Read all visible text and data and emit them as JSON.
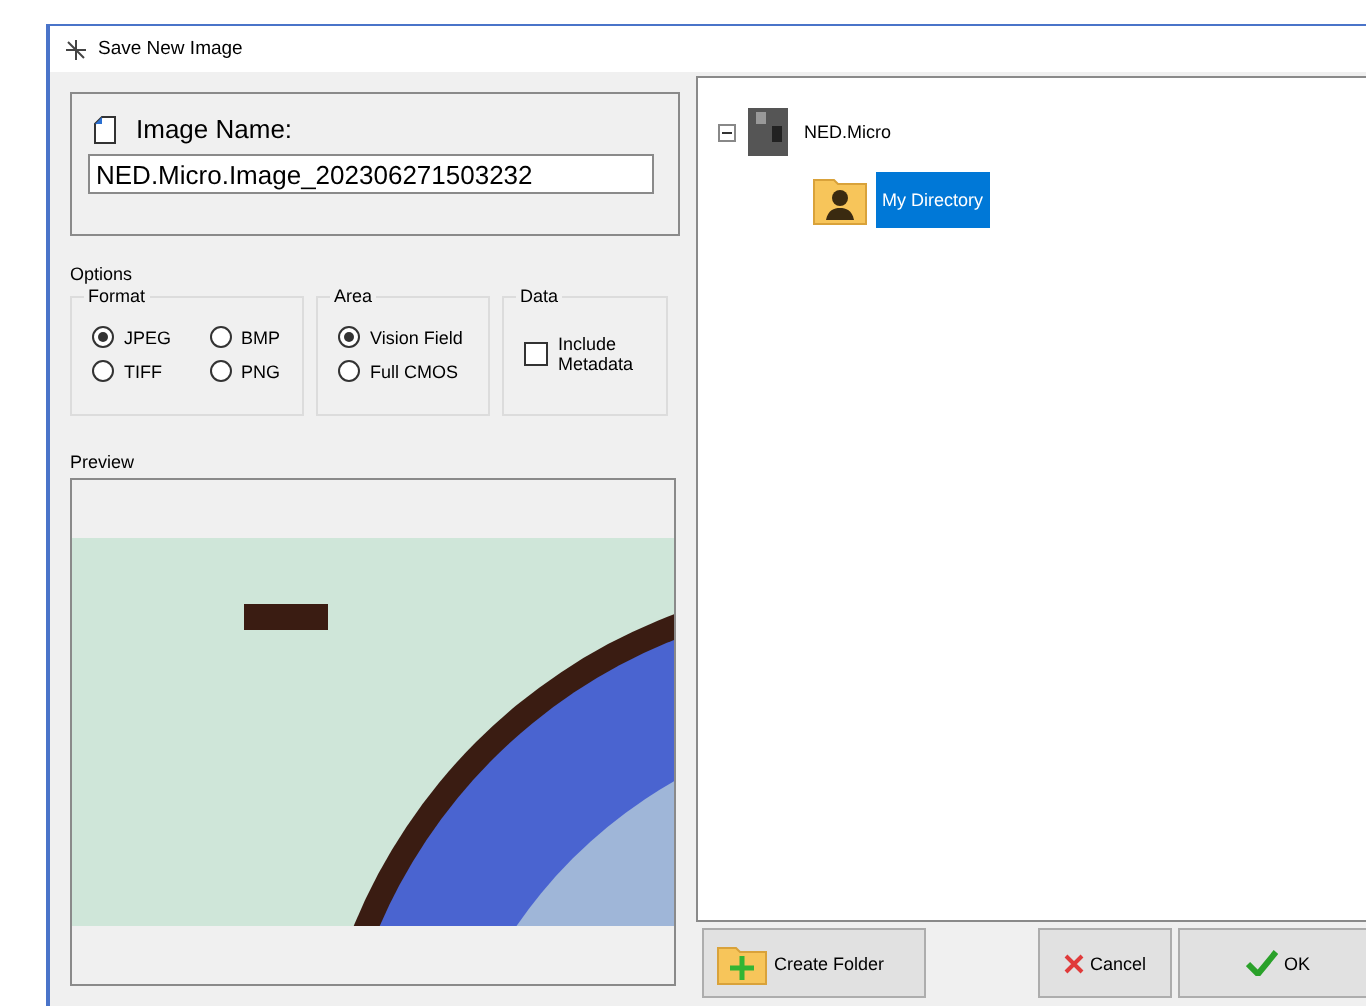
{
  "window": {
    "title": "Save New Image"
  },
  "image_name": {
    "label": "Image Name:",
    "value": "NED.Micro.Image_202306271503232"
  },
  "options": {
    "label": "Options",
    "groups": [
      {
        "kind": "radio",
        "label": "Format",
        "items": [
          {
            "label": "JPEG",
            "selected": true
          },
          {
            "label": "BMP",
            "selected": false
          },
          {
            "label": "TIFF",
            "selected": false
          },
          {
            "label": "PNG",
            "selected": false
          }
        ]
      },
      {
        "kind": "radio",
        "label": "Area",
        "items": [
          {
            "label": "Vision Field",
            "selected": true
          },
          {
            "label": "Full CMOS",
            "selected": false
          }
        ]
      },
      {
        "kind": "checkbox",
        "label": "Data",
        "items": [
          {
            "label": "Include Metadata",
            "checked": false
          }
        ]
      }
    ]
  },
  "preview": {
    "label": "Preview"
  },
  "tree": [
    {
      "label": "NED.Micro",
      "kind": "device",
      "expanded": true,
      "selected": false,
      "children": [
        {
          "label": "My Directory",
          "kind": "user-folder",
          "selected": true
        }
      ]
    }
  ],
  "buttons": [
    {
      "label": "Create Folder",
      "kind": "create"
    },
    {
      "label": "Cancel",
      "kind": "cancel"
    },
    {
      "label": "OK",
      "kind": "ok"
    }
  ]
}
